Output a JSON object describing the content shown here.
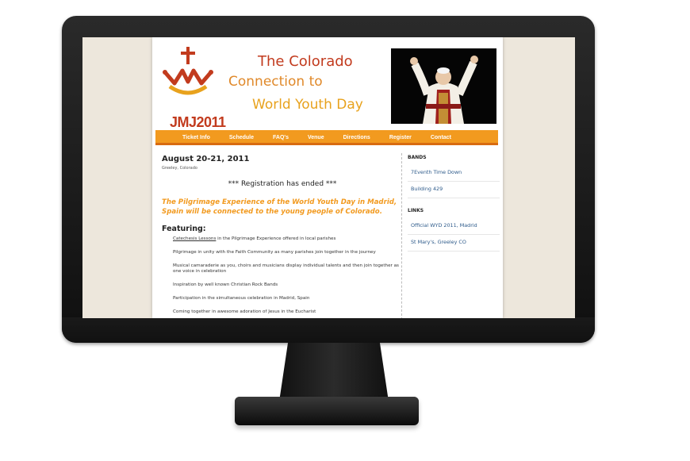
{
  "site": {
    "logo_text": "JMJ2011",
    "title_line1": "The Colorado",
    "title_line2": "Connection to",
    "title_line3": "World Youth Day"
  },
  "nav": {
    "items": [
      {
        "label": "Ticket Info"
      },
      {
        "label": "Schedule"
      },
      {
        "label": "FAQ's"
      },
      {
        "label": "Venue"
      },
      {
        "label": "Directions"
      },
      {
        "label": "Register"
      },
      {
        "label": "Contact"
      }
    ]
  },
  "main": {
    "date": "August 20-21, 2011",
    "location": "Greeley, Colorado",
    "registration": "*** Registration has ended ***",
    "intro": "The Pilgrimage Experience of the World Youth Day in Madrid, Spain will be connected to the young people of Colorado.",
    "featuring_heading": "Featuring:",
    "features": [
      {
        "link": "Catechesis Lessons",
        "text": " in the Pilgrimage Experience offered in local parishes"
      },
      {
        "link": "",
        "text": "Pilgrimage in unity with the Faith Community as many parishes join together in the journey"
      },
      {
        "link": "",
        "text": "Musical camaraderie as you, choirs and musicians display individual talents and then join together as one voice in celebration"
      },
      {
        "link": "",
        "text": "Inspiration by well known Christian Rock Bands"
      },
      {
        "link": "",
        "text": "Participation in the simultaneous celebration in Madrid, Spain"
      },
      {
        "link": "",
        "text": "Coming together in awesome adoration of Jesus in the Eucharist"
      }
    ]
  },
  "sidebar": {
    "bands_heading": "BANDS",
    "bands": [
      {
        "label": "7Eventh Time Down"
      },
      {
        "label": "Building 429"
      }
    ],
    "links_heading": "LINKS",
    "links": [
      {
        "label": "Official WYD 2011, Madrid"
      },
      {
        "label": "St Mary's, Greeley CO"
      }
    ]
  },
  "colors": {
    "accent_orange": "#f29a1f",
    "title_red": "#c23b1e",
    "link_blue": "#2d5a8a"
  }
}
